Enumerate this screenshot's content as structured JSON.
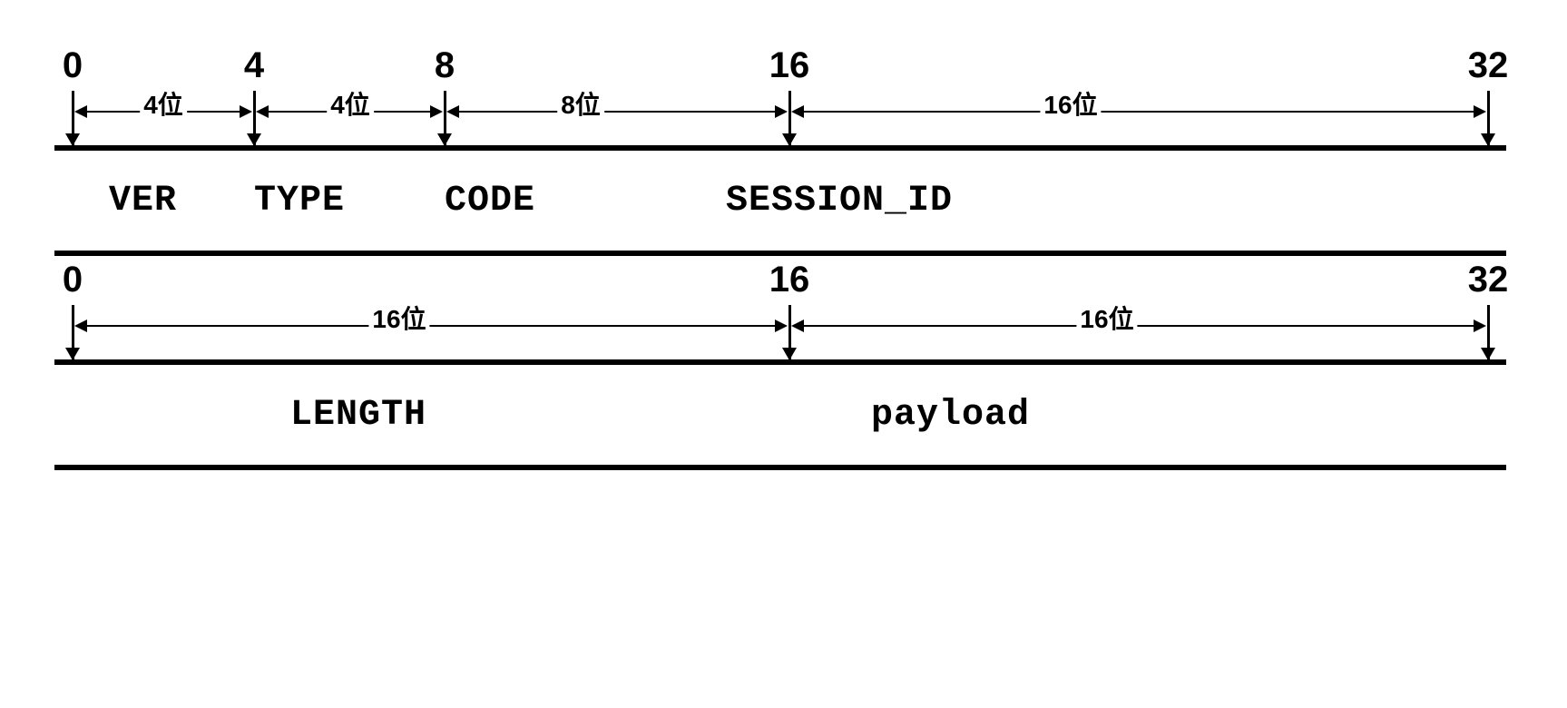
{
  "row1": {
    "positions": {
      "p0": "0",
      "p4": "4",
      "p8": "8",
      "p16": "16",
      "p32": "32"
    },
    "widths": {
      "w0_4": "4位",
      "w4_8": "4位",
      "w8_16": "8位",
      "w16_32": "16位"
    },
    "fields": {
      "ver": "VER",
      "type": "TYPE",
      "code": "CODE",
      "session": "SESSION_ID"
    }
  },
  "row2": {
    "positions": {
      "p0": "0",
      "p16": "16",
      "p32": "32"
    },
    "widths": {
      "w0_16": "16位",
      "w16_32": "16位"
    },
    "fields": {
      "length": "LENGTH",
      "payload": "payload"
    }
  }
}
